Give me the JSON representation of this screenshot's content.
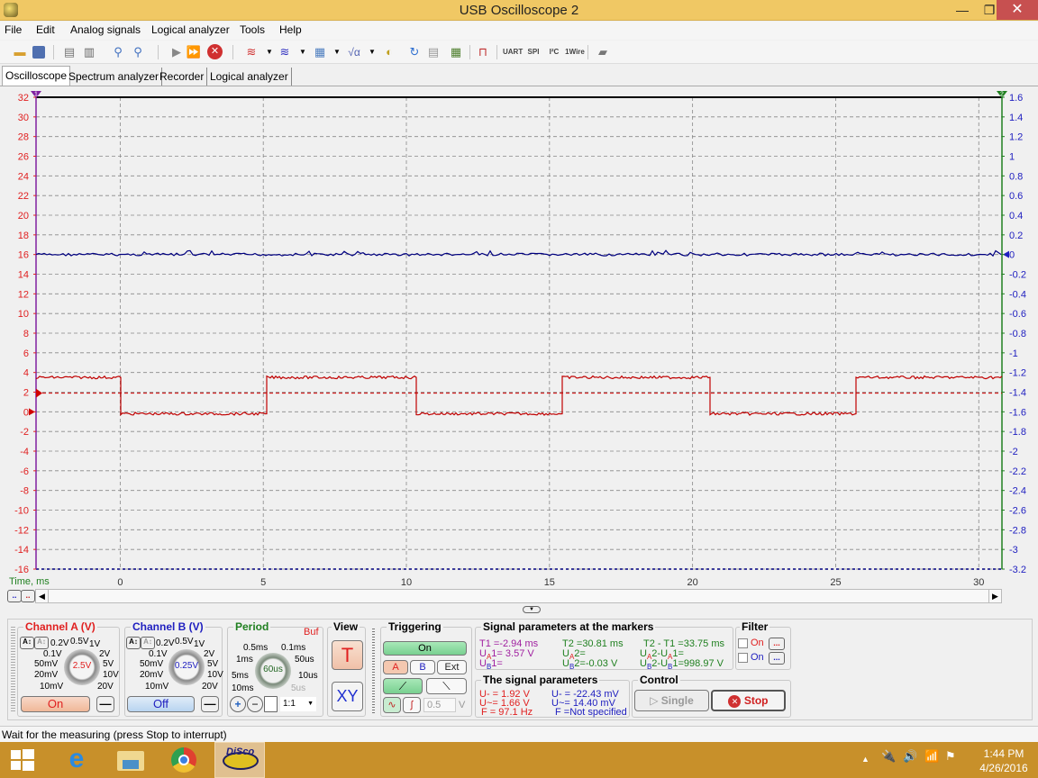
{
  "window": {
    "title": "USB Oscilloscope 2",
    "minimize_glyph": "—",
    "maximize_glyph": "❐",
    "close_glyph": "✕"
  },
  "menu": [
    "File",
    "Edit",
    "Analog signals",
    "Logical analyzer",
    "Tools",
    "Help"
  ],
  "toolbar": {
    "icons": [
      "open-icon",
      "save-icon",
      "print-preview-icon",
      "print-icon",
      "zoom-icon",
      "zoom-region-icon",
      "run-icon",
      "run-continuous-icon",
      "stop-icon",
      "channel-a-math-icon",
      "channel-b-math-icon",
      "calculator-icon",
      "sqrt-math-icon",
      "sound-icon",
      "refresh-icon",
      "notes-icon",
      "table-icon",
      "timer-icon",
      "uart-icon",
      "spi-icon",
      "i2c-icon",
      "1wire-icon",
      "chip-icon"
    ],
    "uart": "UART",
    "spi": "SPI",
    "i2c": "I²C",
    "wire": "1Wire"
  },
  "tabs": [
    "Oscilloscope",
    "Spectrum analyzer",
    "Recorder",
    "Logical analyzer"
  ],
  "active_tab": "Oscilloscope",
  "plot": {
    "left_axis": {
      "min": -16,
      "max": 32,
      "step": 2,
      "color": "#e02020"
    },
    "right_axis": {
      "min": -3.2,
      "max": 1.6,
      "step": 0.2,
      "color": "#2020c0"
    },
    "x_axis": {
      "label": "Time, ms",
      "min": -2.94,
      "max": 30.81,
      "ticks": [
        0,
        5,
        10,
        15,
        20,
        25,
        30
      ]
    },
    "marker1_label": "1",
    "marker2_label": "2",
    "trigger_level_v": 1.9,
    "channel_a": {
      "color": "#c00000",
      "high_v": 3.5,
      "low_v": -0.2,
      "period_ms": 10.3,
      "first_fall_ms": 0.0,
      "first_rise_ms": 5.1
    },
    "channel_b": {
      "color": "#000080",
      "level_left_units": 16
    }
  },
  "scroll": {
    "btn1": "..",
    "btn2": "..",
    "left_arrow": "◀",
    "right_arrow": "▶",
    "collapse": "▼"
  },
  "channel_a": {
    "title": "Channel A (V)",
    "scales": [
      "0.2V",
      "0.5V",
      "1V",
      "0.1V",
      "2V",
      "50mV",
      "5V",
      "20mV",
      "10V",
      "10mV",
      "20V"
    ],
    "value": "2.5V",
    "state": "On",
    "minus": "—"
  },
  "channel_b": {
    "title": "Channel B (V)",
    "scales": [
      "0.2V",
      "0.5V",
      "1V",
      "0.1V",
      "2V",
      "50mV",
      "5V",
      "20mV",
      "10V",
      "10mV",
      "20V"
    ],
    "value": "0.25V",
    "state": "Off",
    "minus": "—"
  },
  "period": {
    "title": "Period",
    "buf": "Buf",
    "scales": [
      "0.5ms",
      "0.1ms",
      "1ms",
      "50us",
      "5ms",
      "10us",
      "10ms",
      "5us"
    ],
    "value": "60us",
    "ratio": "1:1"
  },
  "view": {
    "title": "View",
    "t": "T",
    "xy": "XY"
  },
  "triggering": {
    "title": "Triggering",
    "on": "On",
    "a": "A",
    "b": "B",
    "ext": "Ext",
    "level": "0.5",
    "unit": "V"
  },
  "markers": {
    "title": "Signal parameters at the markers",
    "t1": "T1 =-2.94 ms",
    "ua1": "3.57 V",
    "ub1": "",
    "t2": "T2 =30.81 ms",
    "ua2": "",
    "ub2": "-0.03 V",
    "dt": "T2 - T1 =33.75 ms",
    "dua": "",
    "dub": "998.97 V"
  },
  "signal": {
    "title": "The signal parameters",
    "a_udc": "U- = 1.92 V",
    "a_uac": "U~= 1.66 V",
    "a_f": "F  = 97.1 Hz",
    "b_udc": "U- = -22.43 mV",
    "b_uac": "U~= 14.40 mV",
    "b_f": "F  =Not specified"
  },
  "filter": {
    "title": "Filter",
    "on_a": "On",
    "on_b": "On",
    "more": "..."
  },
  "control": {
    "title": "Control",
    "single": "Single",
    "stop": "Stop"
  },
  "status": "Wait for the measuring (press Stop to interrupt)",
  "taskbar": {
    "apps": [
      "windows-start",
      "internet-explorer",
      "file-explorer",
      "chrome",
      "disco-app"
    ],
    "time": "1:44 PM",
    "date": "4/26/2016"
  }
}
